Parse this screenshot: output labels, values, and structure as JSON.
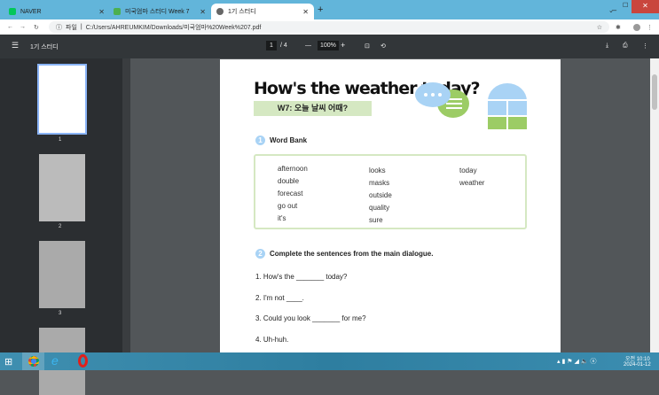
{
  "browser": {
    "tabs": [
      {
        "label": "NAVER",
        "color": "#03c75a"
      },
      {
        "label": "미국엄마 스터디 Week 7",
        "color": "#4caf50"
      },
      {
        "label": "1기 스터디",
        "color": "#555"
      }
    ],
    "address_prefix": "파일",
    "url": "C:/Users/AHREUMKIM/Downloads/미국엄마%20Week%207.pdf"
  },
  "viewer": {
    "title": "1기 스터디",
    "page_current": "1",
    "page_total": "/ 4",
    "zoom": "100%"
  },
  "thumbnails": [
    "1",
    "2",
    "3"
  ],
  "page": {
    "title": "How's the weather today?",
    "subtitle": "W7: 오늘 날씨 어때?",
    "section1": {
      "num": "1",
      "label": "Word Bank"
    },
    "word_bank": [
      [
        "afternoon",
        "double",
        "forecast",
        "go out",
        "it's"
      ],
      [
        "looks",
        "masks",
        "outside",
        "quality",
        "sure"
      ],
      [
        "today",
        "weather"
      ]
    ],
    "section2": {
      "num": "2",
      "label": "Complete the sentences from the main dialogue."
    },
    "sentences": [
      "1. How's the _______ today?",
      "2. I'm not ____.",
      "3. Could you look _______ for me?",
      "4. Uh-huh."
    ]
  },
  "taskbar": {
    "time": "오전 10:10",
    "date": "2024-01-12"
  }
}
